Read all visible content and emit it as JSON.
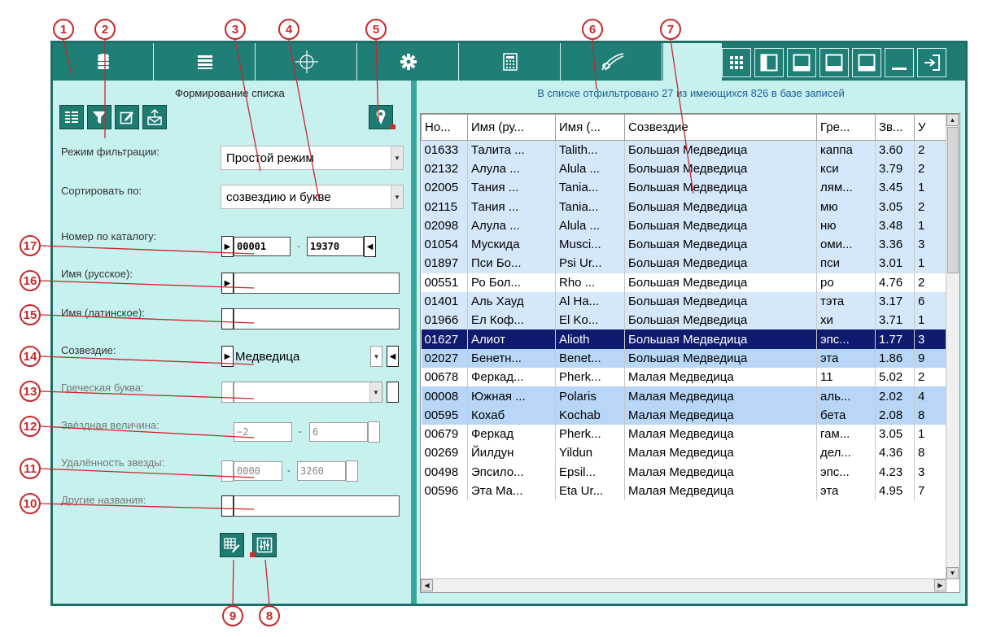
{
  "colors": {
    "toolbar": "#1e7b72",
    "panel_bg": "#c6f1ef",
    "selection": "#0f1b6e",
    "callout": "#c8282a",
    "status_text": "#1c5f95"
  },
  "toolbar": {
    "icons": [
      "database-icon",
      "list-icon",
      "crosshair-icon",
      "gear-icon",
      "calculator-icon",
      "comet-icon"
    ],
    "window_icons": [
      "grid-view-icon",
      "left-panel-icon",
      "top-panel-icon",
      "bottom-panel-icon",
      "window-icon",
      "minimize-icon",
      "exit-icon"
    ]
  },
  "left_panel": {
    "title": "Формирование списка",
    "filter_mode_label": "Режим фильтрации:",
    "filter_mode_value": "Простой режим",
    "sort_label": "Сортировать по:",
    "sort_value": "созвездию и букве",
    "catalog_label": "Номер по каталогу:",
    "catalog_from": "00001",
    "catalog_to": "19370",
    "name_ru_label": "Имя (русское):",
    "name_lat_label": "Имя (латинское):",
    "constellation_label": "Созвездие:",
    "constellation_value": "Медведица",
    "greek_label": "Греческая буква:",
    "magnitude_label": "Звёздная величина:",
    "magnitude_from": "−2",
    "magnitude_to": "6",
    "distance_label": "Удалённость звезды:",
    "distance_from": "0000",
    "distance_to": "3260",
    "other_names_label": "Другие названия:",
    "range_separator": "-"
  },
  "table": {
    "status": "В списке отфильтровано 27 из имеющихся 826 в базе записей",
    "columns": [
      "Но...",
      "Имя (ру...",
      "Имя (...",
      "Созвездие",
      "Гре...",
      "Зв...",
      "У"
    ],
    "rows": [
      [
        "01633",
        "Талита ...",
        "Talith...",
        "Большая Медведица",
        "каппа",
        "3.60",
        "2"
      ],
      [
        "02132",
        "Алула ...",
        "Alula ...",
        "Большая Медведица",
        "кси",
        "3.79",
        "2"
      ],
      [
        "02005",
        "Тания ...",
        "Tania...",
        "Большая Медведица",
        "лям...",
        "3.45",
        "1"
      ],
      [
        "02115",
        "Тания ...",
        "Tania...",
        "Большая Медведица",
        "мю",
        "3.05",
        "2"
      ],
      [
        "02098",
        "Алула ...",
        "Alula ...",
        "Большая Медведица",
        "ню",
        "3.48",
        "1"
      ],
      [
        "01054",
        "Мускида",
        "Musci...",
        "Большая Медведица",
        "оми...",
        "3.36",
        "3"
      ],
      [
        "01897",
        "Пси Бо...",
        "Psi Ur...",
        "Большая Медведица",
        "пси",
        "3.01",
        "1"
      ],
      [
        "00551",
        "Ро Бол...",
        "Rho ...",
        "Большая Медведица",
        "ро",
        "4.76",
        "2"
      ],
      [
        "01401",
        "Аль Хауд",
        "Al Ha...",
        "Большая Медведица",
        "тэта",
        "3.17",
        "6"
      ],
      [
        "01966",
        "Ел Коф...",
        "El Ko...",
        "Большая Медведица",
        "хи",
        "3.71",
        "1"
      ],
      [
        "01627",
        "Алиот",
        "Alioth",
        "Большая Медведица",
        "эпс...",
        "1.77",
        "3"
      ],
      [
        "02027",
        "Бенетн...",
        "Benet...",
        "Большая Медведица",
        "эта",
        "1.86",
        "9"
      ],
      [
        "00678",
        "Феркад...",
        "Pherk...",
        "Малая Медведица",
        "11",
        "5.02",
        "2"
      ],
      [
        "00008",
        "Южная ...",
        "Polaris",
        "Малая Медведица",
        "аль...",
        "2.02",
        "4"
      ],
      [
        "00595",
        "Кохаб",
        "Kochab",
        "Малая Медведица",
        "бета",
        "2.08",
        "8"
      ],
      [
        "00679",
        "Феркад",
        "Pherk...",
        "Малая Медведица",
        "гам...",
        "3.05",
        "1"
      ],
      [
        "00269",
        "Йилдун",
        "Yildun",
        "Малая Медведица",
        "дел...",
        "4.36",
        "8"
      ],
      [
        "00498",
        "Эпсило...",
        "Epsil...",
        "Малая Медведица",
        "эпс...",
        "4.23",
        "3"
      ],
      [
        "00596",
        "Эта Ма...",
        "Eta Ur...",
        "Малая Медведица",
        "эта",
        "4.95",
        "7"
      ]
    ],
    "row_styles": [
      "a",
      "a",
      "a",
      "a",
      "a",
      "a",
      "a",
      "w",
      "a",
      "a",
      "sel",
      "b",
      "w",
      "b",
      "b",
      "w",
      "w",
      "w",
      "w"
    ]
  },
  "callouts": [
    "1",
    "2",
    "3",
    "4",
    "5",
    "6",
    "7",
    "8",
    "9",
    "10",
    "11",
    "12",
    "13",
    "14",
    "15",
    "16",
    "17"
  ]
}
